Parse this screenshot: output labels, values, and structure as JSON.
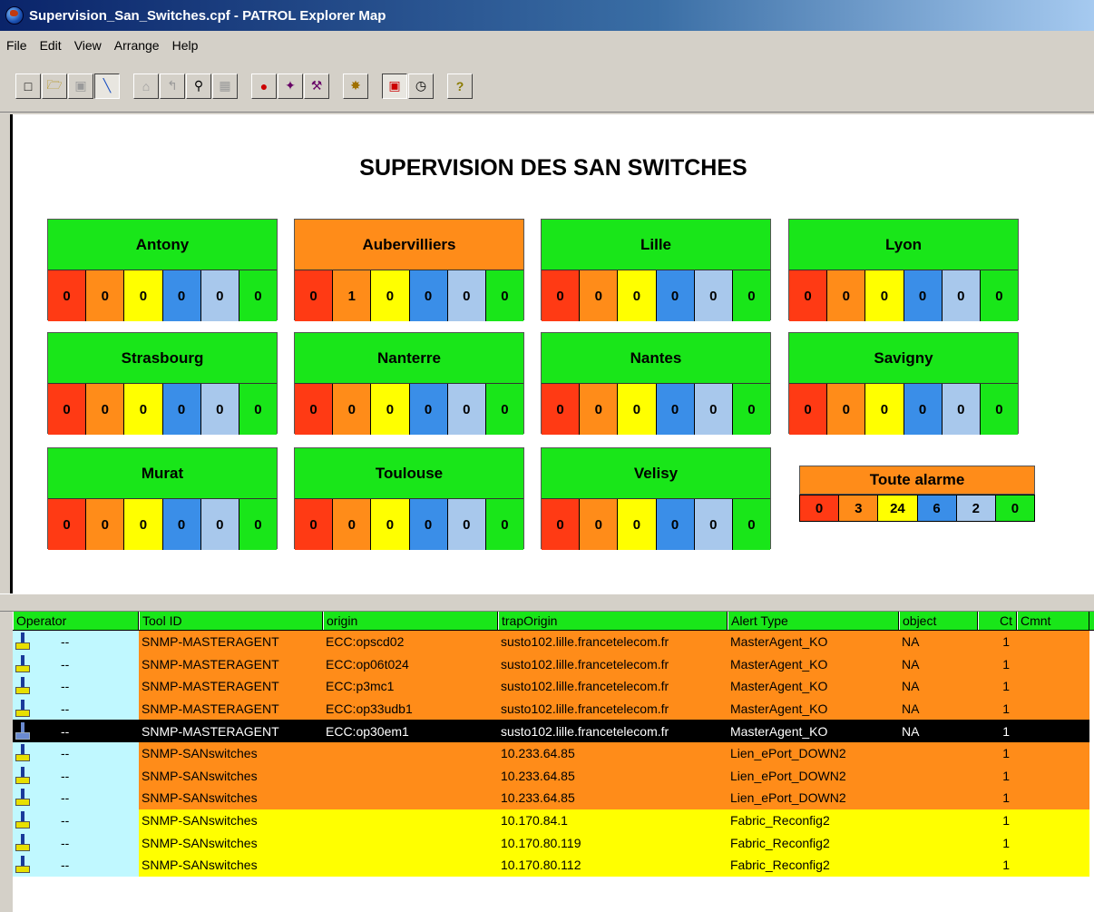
{
  "window": {
    "title": "Supervision_San_Switches.cpf - PATROL Explorer Map"
  },
  "menu": [
    "File",
    "Edit",
    "View",
    "Arrange",
    "Help"
  ],
  "toolbar_icons": [
    [
      "new-icon",
      "open-icon",
      "save-icon",
      "connect-icon"
    ],
    [
      "home-icon",
      "up-icon",
      "find-icon",
      "properties-icon"
    ],
    [
      "traffic-light-icon",
      "events-icon",
      "tools-icon"
    ],
    [
      "alarm-icon"
    ],
    [
      "map-view-icon",
      "window-icon"
    ],
    [
      "help-icon"
    ]
  ],
  "map": {
    "title": "SUPERVISION DES SAN SWITCHES",
    "sites": [
      {
        "name": "Antony",
        "header_color": "green",
        "counts": [
          "0",
          "0",
          "0",
          "0",
          "0",
          "0"
        ]
      },
      {
        "name": "Aubervilliers",
        "header_color": "orange",
        "counts": [
          "0",
          "1",
          "0",
          "0",
          "0",
          "0"
        ]
      },
      {
        "name": "Lille",
        "header_color": "green",
        "counts": [
          "0",
          "0",
          "0",
          "0",
          "0",
          "0"
        ]
      },
      {
        "name": "Lyon",
        "header_color": "green",
        "counts": [
          "0",
          "0",
          "0",
          "0",
          "0",
          "0"
        ]
      },
      {
        "name": "Strasbourg",
        "header_color": "green",
        "counts": [
          "0",
          "0",
          "0",
          "0",
          "0",
          "0"
        ]
      },
      {
        "name": "Nanterre",
        "header_color": "green",
        "counts": [
          "0",
          "0",
          "0",
          "0",
          "0",
          "0"
        ]
      },
      {
        "name": "Nantes",
        "header_color": "green",
        "counts": [
          "0",
          "0",
          "0",
          "0",
          "0",
          "0"
        ]
      },
      {
        "name": "Savigny",
        "header_color": "green",
        "counts": [
          "0",
          "0",
          "0",
          "0",
          "0",
          "0"
        ]
      },
      {
        "name": "Murat",
        "header_color": "green",
        "counts": [
          "0",
          "0",
          "0",
          "0",
          "0",
          "0"
        ]
      },
      {
        "name": "Toulouse",
        "header_color": "green",
        "counts": [
          "0",
          "0",
          "0",
          "0",
          "0",
          "0"
        ]
      },
      {
        "name": "Velisy",
        "header_color": "green",
        "counts": [
          "0",
          "0",
          "0",
          "0",
          "0",
          "0"
        ]
      }
    ],
    "all_alarms": {
      "name": "Toute alarme",
      "counts": [
        "0",
        "3",
        "24",
        "6",
        "2",
        "0"
      ]
    },
    "severity_colors": [
      "#ff3a14",
      "#ff8c19",
      "#ffff00",
      "#3a8ee8",
      "#a8c8ec",
      "#19e619"
    ]
  },
  "grid": {
    "columns": [
      "Operator",
      "Tool ID",
      "origin",
      "trapOrigin",
      "Alert Type",
      "object",
      "Ct",
      "Cmnt"
    ],
    "rows": [
      {
        "color": "orange",
        "selected": false,
        "operator": "--",
        "tool_id": "SNMP-MASTERAGENT",
        "origin": "ECC:opscd02",
        "trap_origin": "susto102.lille.francetelecom.fr",
        "alert_type": "MasterAgent_KO",
        "object": "NA",
        "ct": "1",
        "cmnt": ""
      },
      {
        "color": "orange",
        "selected": false,
        "operator": "--",
        "tool_id": "SNMP-MASTERAGENT",
        "origin": "ECC:op06t024",
        "trap_origin": "susto102.lille.francetelecom.fr",
        "alert_type": "MasterAgent_KO",
        "object": "NA",
        "ct": "1",
        "cmnt": ""
      },
      {
        "color": "orange",
        "selected": false,
        "operator": "--",
        "tool_id": "SNMP-MASTERAGENT",
        "origin": "ECC:p3mc1",
        "trap_origin": "susto102.lille.francetelecom.fr",
        "alert_type": "MasterAgent_KO",
        "object": "NA",
        "ct": "1",
        "cmnt": ""
      },
      {
        "color": "orange",
        "selected": false,
        "operator": "--",
        "tool_id": "SNMP-MASTERAGENT",
        "origin": "ECC:op33udb1",
        "trap_origin": "susto102.lille.francetelecom.fr",
        "alert_type": "MasterAgent_KO",
        "object": "NA",
        "ct": "1",
        "cmnt": ""
      },
      {
        "color": "orange",
        "selected": true,
        "operator": "--",
        "tool_id": "SNMP-MASTERAGENT",
        "origin": "ECC:op30em1",
        "trap_origin": "susto102.lille.francetelecom.fr",
        "alert_type": "MasterAgent_KO",
        "object": "NA",
        "ct": "1",
        "cmnt": ""
      },
      {
        "color": "orange",
        "selected": false,
        "operator": "--",
        "tool_id": "SNMP-SANswitches",
        "origin": "",
        "trap_origin": "10.233.64.85",
        "alert_type": "Lien_ePort_DOWN2",
        "object": "",
        "ct": "1",
        "cmnt": ""
      },
      {
        "color": "orange",
        "selected": false,
        "operator": "--",
        "tool_id": "SNMP-SANswitches",
        "origin": "",
        "trap_origin": "10.233.64.85",
        "alert_type": "Lien_ePort_DOWN2",
        "object": "",
        "ct": "1",
        "cmnt": ""
      },
      {
        "color": "orange",
        "selected": false,
        "operator": "--",
        "tool_id": "SNMP-SANswitches",
        "origin": "",
        "trap_origin": "10.233.64.85",
        "alert_type": "Lien_ePort_DOWN2",
        "object": "",
        "ct": "1",
        "cmnt": ""
      },
      {
        "color": "yellow",
        "selected": false,
        "operator": "--",
        "tool_id": "SNMP-SANswitches",
        "origin": "",
        "trap_origin": "10.170.84.1",
        "alert_type": "Fabric_Reconfig2",
        "object": "",
        "ct": "1",
        "cmnt": ""
      },
      {
        "color": "yellow",
        "selected": false,
        "operator": "--",
        "tool_id": "SNMP-SANswitches",
        "origin": "",
        "trap_origin": "10.170.80.119",
        "alert_type": "Fabric_Reconfig2",
        "object": "",
        "ct": "1",
        "cmnt": ""
      },
      {
        "color": "yellow",
        "selected": false,
        "operator": "--",
        "tool_id": "SNMP-SANswitches",
        "origin": "",
        "trap_origin": "10.170.80.112",
        "alert_type": "Fabric_Reconfig2",
        "object": "",
        "ct": "1",
        "cmnt": ""
      }
    ]
  }
}
